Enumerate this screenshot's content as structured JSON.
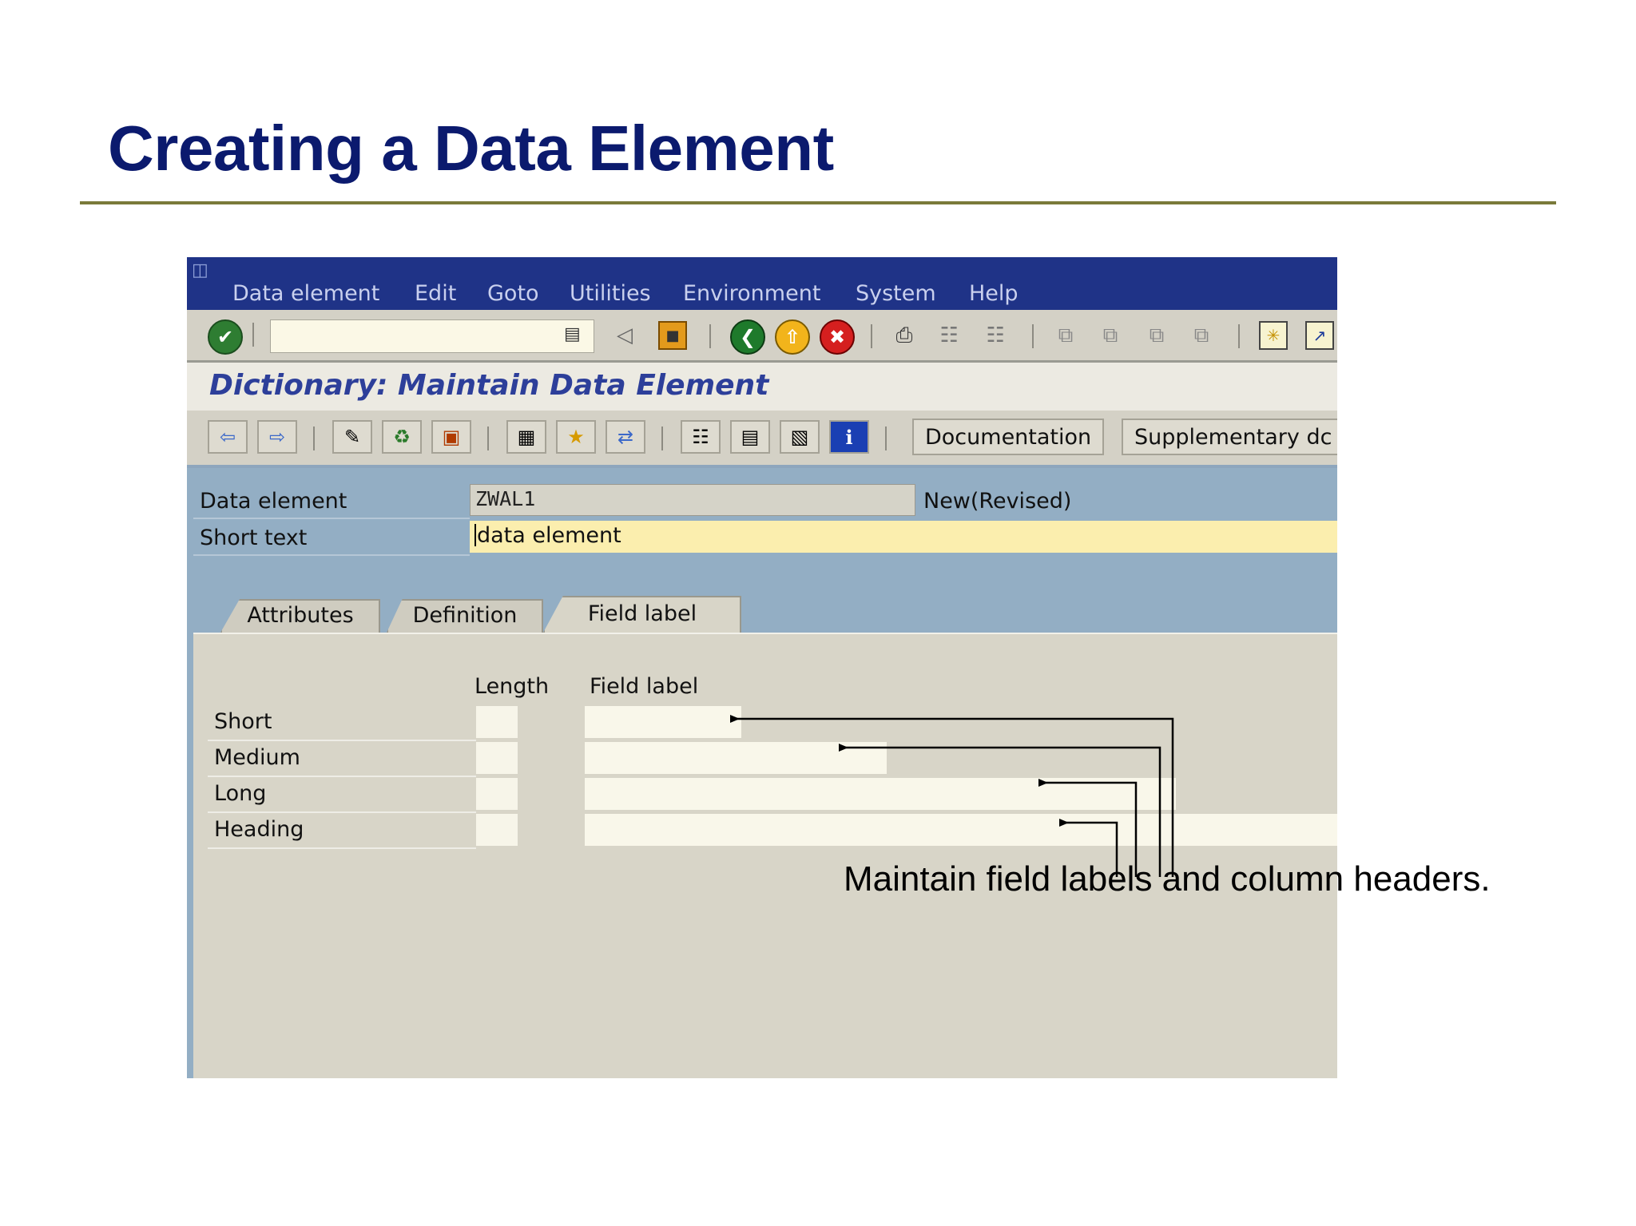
{
  "slide": {
    "title": "Creating a Data Element",
    "annotation": "Maintain field labels and column headers."
  },
  "menu": {
    "items": [
      "Data element",
      "Edit",
      "Goto",
      "Utilities",
      "Environment",
      "System",
      "Help"
    ]
  },
  "screen": {
    "title": "Dictionary: Maintain Data Element",
    "buttons": {
      "documentation": "Documentation",
      "supplementary": "Supplementary dc"
    }
  },
  "header": {
    "data_element_label": "Data element",
    "data_element_value": "ZWAL1",
    "status": "New(Revised)",
    "short_text_label": "Short text",
    "short_text_value": "data element"
  },
  "tabs": [
    "Attributes",
    "Definition",
    "Field label"
  ],
  "active_tab": "Field label",
  "field_labels": {
    "col_length": "Length",
    "col_label": "Field label",
    "rows": [
      "Short",
      "Medium",
      "Long",
      "Heading"
    ]
  },
  "icons": {
    "toolbar1": [
      "check-icon",
      "command-field-menu-icon",
      "back-triangle-icon",
      "save-icon",
      "back-icon",
      "exit-icon",
      "cancel-icon",
      "print-icon",
      "find-icon",
      "find-next-icon",
      "first-page-icon",
      "previous-page-icon",
      "next-page-icon",
      "last-page-icon",
      "create-session-icon",
      "shortcut-icon"
    ],
    "toolbar2": [
      "back-arrow-icon",
      "forward-arrow-icon",
      "display-change-icon",
      "check-object-icon",
      "activate-icon",
      "where-used-icon",
      "display-object-list-icon",
      "navigation-window-icon",
      "hierarchy-icon",
      "print-list-icon",
      "layout-icon",
      "info-icon"
    ]
  },
  "colors": {
    "title": "#0b1a6e",
    "menubar": "#1f3387",
    "header_area": "#93aec4",
    "short_text_field": "#fbeeae"
  }
}
